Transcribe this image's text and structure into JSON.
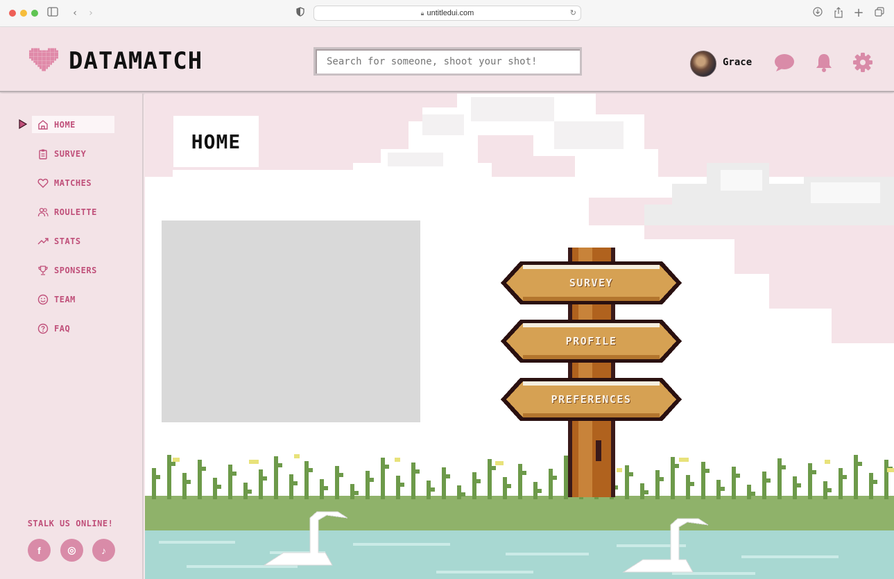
{
  "browser": {
    "url": "untitledui.com"
  },
  "header": {
    "brand": "DATAMATCH",
    "search_placeholder": "Search for someone, shoot your shot!",
    "username": "Grace"
  },
  "sidebar": {
    "items": [
      {
        "label": "HOME",
        "icon": "home-icon",
        "active": true
      },
      {
        "label": "SURVEY",
        "icon": "clipboard-icon"
      },
      {
        "label": "MATCHES",
        "icon": "heart-icon"
      },
      {
        "label": "ROULETTE",
        "icon": "users-icon"
      },
      {
        "label": "STATS",
        "icon": "trend-up-icon"
      },
      {
        "label": "SPONSERS",
        "icon": "trophy-icon"
      },
      {
        "label": "TEAM",
        "icon": "smile-icon"
      },
      {
        "label": "FAQ",
        "icon": "help-circle-icon"
      }
    ],
    "social_heading": "STALK US ONLINE!",
    "social": [
      {
        "name": "facebook",
        "glyph": "f"
      },
      {
        "name": "instagram",
        "glyph": "◎"
      },
      {
        "name": "tiktok",
        "glyph": "♪"
      }
    ]
  },
  "main": {
    "page_title": "HOME",
    "signs": [
      "SURVEY",
      "PROFILE",
      "PREFERENCES"
    ]
  },
  "colors": {
    "accent": "#c0507a",
    "sidebar_bg": "#f3e3e7",
    "icon_pink": "#d98ba8"
  }
}
